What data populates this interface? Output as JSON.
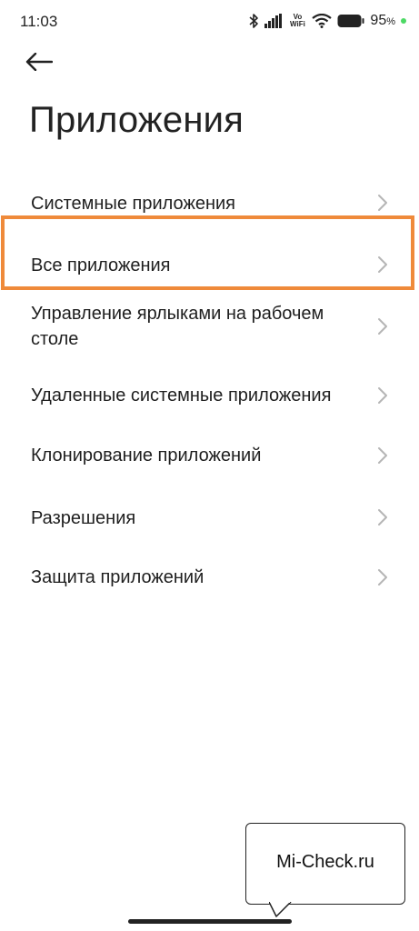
{
  "status_bar": {
    "time": "11:03",
    "volte_top": "Vo",
    "volte_bottom": "WiFi",
    "battery_percent": "95",
    "battery_unit": "%",
    "charge_color": "#4cd964",
    "icons": [
      "bluetooth-icon",
      "signal-icon",
      "volte-wifi-icon",
      "wifi-icon",
      "battery-icon"
    ]
  },
  "header": {
    "back_icon": "arrow-left-icon",
    "title": "Приложения"
  },
  "menu": {
    "items": [
      {
        "label": "Системные приложения"
      },
      {
        "label": "Все приложения"
      },
      {
        "label": "Управление ярлыками на рабочем столе"
      },
      {
        "label": "Удаленные системные приложения"
      },
      {
        "label": "Клонирование приложений"
      },
      {
        "label": "Разрешения"
      },
      {
        "label": "Защита приложений"
      }
    ],
    "chevron_icon": "chevron-right-icon",
    "highlight_color": "#ef8a3a"
  },
  "watermark": {
    "text": "Mi-Check.ru"
  }
}
